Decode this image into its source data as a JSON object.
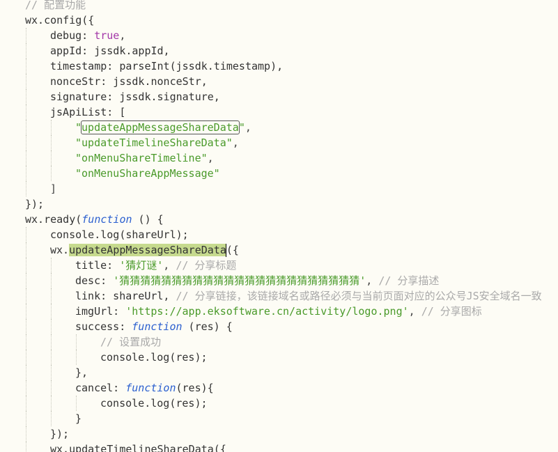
{
  "editor": {
    "colors": {
      "background": "#fdfcf5",
      "comment": "#a9a9a9",
      "string": "#4a9a2a",
      "keyword": "#a337a8",
      "function_keyword": "#2b5fcf",
      "selection": "#c6da8e"
    },
    "lines": [
      {
        "indent": 1,
        "tokens": [
          {
            "t": "// 配置功能",
            "c": "comment"
          }
        ]
      },
      {
        "indent": 1,
        "tokens": [
          {
            "t": "wx.config({",
            "c": "plain"
          }
        ]
      },
      {
        "indent": 2,
        "tokens": [
          {
            "t": "debug: ",
            "c": "plain"
          },
          {
            "t": "true",
            "c": "kw"
          },
          {
            "t": ",",
            "c": "punct"
          }
        ]
      },
      {
        "indent": 2,
        "tokens": [
          {
            "t": "appId: jssdk.appId,",
            "c": "plain"
          }
        ]
      },
      {
        "indent": 2,
        "tokens": [
          {
            "t": "timestamp: parseInt(jssdk.timestamp),",
            "c": "plain"
          }
        ]
      },
      {
        "indent": 2,
        "tokens": [
          {
            "t": "nonceStr: jssdk.nonceStr,",
            "c": "plain"
          }
        ]
      },
      {
        "indent": 2,
        "tokens": [
          {
            "t": "signature: jssdk.signature,",
            "c": "plain"
          }
        ]
      },
      {
        "indent": 2,
        "tokens": [
          {
            "t": "jsApiList: [",
            "c": "plain"
          }
        ]
      },
      {
        "indent": 3,
        "tokens": [
          {
            "t": "\"",
            "c": "str"
          },
          {
            "t": "updateAppMessageShareData",
            "c": "str",
            "hl": "box"
          },
          {
            "t": "\"",
            "c": "str"
          },
          {
            "t": ",",
            "c": "punct"
          }
        ]
      },
      {
        "indent": 3,
        "tokens": [
          {
            "t": "\"updateTimelineShareData\"",
            "c": "str"
          },
          {
            "t": ",",
            "c": "punct"
          }
        ]
      },
      {
        "indent": 3,
        "tokens": [
          {
            "t": "\"onMenuShareTimeline\"",
            "c": "str"
          },
          {
            "t": ",",
            "c": "punct"
          }
        ]
      },
      {
        "indent": 3,
        "tokens": [
          {
            "t": "\"onMenuShareAppMessage\"",
            "c": "str"
          }
        ]
      },
      {
        "indent": 2,
        "tokens": [
          {
            "t": "]",
            "c": "punct"
          }
        ]
      },
      {
        "indent": 1,
        "tokens": [
          {
            "t": "});",
            "c": "plain"
          }
        ]
      },
      {
        "indent": 1,
        "tokens": [
          {
            "t": "wx.ready(",
            "c": "plain"
          },
          {
            "t": "function",
            "c": "fn"
          },
          {
            "t": " () {",
            "c": "plain"
          }
        ]
      },
      {
        "indent": 2,
        "tokens": [
          {
            "t": "console.log(shareUrl);",
            "c": "plain"
          }
        ]
      },
      {
        "indent": 2,
        "tokens": [
          {
            "t": "wx.",
            "c": "plain"
          },
          {
            "t": "updateAppMessageShareData",
            "c": "plain",
            "hl": "sel"
          },
          {
            "t": "|",
            "c": "cursor"
          },
          {
            "t": "({",
            "c": "plain"
          }
        ]
      },
      {
        "indent": 3,
        "tokens": [
          {
            "t": "title: ",
            "c": "plain"
          },
          {
            "t": "'猜灯谜'",
            "c": "str"
          },
          {
            "t": ", ",
            "c": "punct"
          },
          {
            "t": "// 分享标题",
            "c": "comment"
          }
        ]
      },
      {
        "indent": 3,
        "tokens": [
          {
            "t": "desc: ",
            "c": "plain"
          },
          {
            "t": "'猜猜猜猜猜猜猜猜猜猜猜猜猜猜猜猜猜猜猜猜猜猜猜'",
            "c": "str"
          },
          {
            "t": ", ",
            "c": "punct"
          },
          {
            "t": "// 分享描述",
            "c": "comment"
          }
        ]
      },
      {
        "indent": 3,
        "tokens": [
          {
            "t": "link: shareUrl, ",
            "c": "plain"
          },
          {
            "t": "// 分享链接，该链接域名或路径必须与当前页面对应的公众号JS安全域名一致",
            "c": "comment"
          }
        ]
      },
      {
        "indent": 3,
        "tokens": [
          {
            "t": "imgUrl: ",
            "c": "plain"
          },
          {
            "t": "'https://app.eksoftware.cn/activity/logo.png'",
            "c": "str"
          },
          {
            "t": ", ",
            "c": "punct"
          },
          {
            "t": "// 分享图标",
            "c": "comment"
          }
        ]
      },
      {
        "indent": 3,
        "tokens": [
          {
            "t": "success: ",
            "c": "plain"
          },
          {
            "t": "function",
            "c": "fn"
          },
          {
            "t": " (res) {",
            "c": "plain"
          }
        ]
      },
      {
        "indent": 4,
        "tokens": [
          {
            "t": "// 设置成功",
            "c": "comment"
          }
        ]
      },
      {
        "indent": 4,
        "tokens": [
          {
            "t": "console.log(res);",
            "c": "plain"
          }
        ]
      },
      {
        "indent": 3,
        "tokens": [
          {
            "t": "},",
            "c": "plain"
          }
        ]
      },
      {
        "indent": 3,
        "tokens": [
          {
            "t": "cancel: ",
            "c": "plain"
          },
          {
            "t": "function",
            "c": "fn"
          },
          {
            "t": "(res){",
            "c": "plain"
          }
        ]
      },
      {
        "indent": 4,
        "tokens": [
          {
            "t": "console.log(res);",
            "c": "plain"
          }
        ]
      },
      {
        "indent": 3,
        "tokens": [
          {
            "t": "}",
            "c": "plain"
          }
        ]
      },
      {
        "indent": 2,
        "tokens": [
          {
            "t": "});",
            "c": "plain"
          }
        ]
      },
      {
        "indent": 2,
        "tokens": [
          {
            "t": "wx.updateTimelineShareData({",
            "c": "plain"
          }
        ]
      }
    ]
  }
}
